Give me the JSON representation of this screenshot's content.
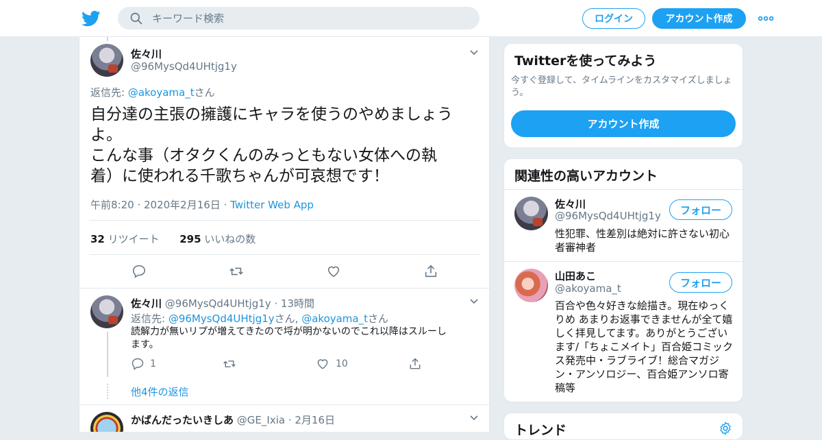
{
  "header": {
    "search_placeholder": "キーワード検索",
    "login_label": "ログイン",
    "signup_label": "アカウント作成"
  },
  "tweet": {
    "name": "佐々川",
    "handle": "@96MysQd4UHtjg1y",
    "reply_prefix": "返信先: ",
    "reply_to": "@akoyama_t",
    "reply_suffix": "さん",
    "text_lines": [
      "自分達の主張の擁護にキャラを使うのやめましょう",
      "よ。",
      "こんな事（オタクくんのみっともない女体への執",
      "着）に使われる千歌ちゃんが可哀想です！"
    ],
    "timestamp": "午前8:20 · 2020年2月16日 · ",
    "source": "Twitter Web App",
    "retweets_count": "32",
    "retweets_label": " リツイート",
    "likes_count": "295",
    "likes_label": " いいねの数"
  },
  "replies": [
    {
      "name": "佐々川",
      "handle": "@96MysQd4UHtjg1y",
      "time": " · 13時間",
      "reply_prefix": "返信先: ",
      "reply_to_1": "@96MysQd4UHtjg1y",
      "reply_mid": "さん, ",
      "reply_to_2": "@akoyama_t",
      "reply_suffix": "さん",
      "text_lines": [
        "読解力が無いリプが増えてきたので埒が明かないのでこれ以降はスルーし",
        "ます。"
      ],
      "reply_count": "1",
      "like_count": "10",
      "more_replies": "他4件の返信"
    },
    {
      "name": "かばんだったいきしあ",
      "handle": "@GE_Ixia",
      "time": " · 2月16日"
    }
  ],
  "sidebar": {
    "signup_card": {
      "title": "Twitterを使ってみよう",
      "desc_lines": [
        "今すぐ登録して、タイムラインをカスタマイズしましょ",
        "う。"
      ],
      "button": "アカウント作成"
    },
    "related": {
      "title": "関連性の高いアカウント",
      "accounts": [
        {
          "name": "佐々川",
          "handle": "@96MysQd4UHtjg1y",
          "follow": "フォロー",
          "bio_lines": [
            "性犯罪、性差別は絶対に許さない初心",
            "者審神者"
          ]
        },
        {
          "name": "山田あこ",
          "handle": "@akoyama_t",
          "follow": "フォロー",
          "bio_lines": [
            "百合や色々好きな絵描き。現在ゆっく",
            "りめ あまりお返事できませんが全て嬉",
            "しく拝見してます。ありがとうござい",
            "ます/「ちょこメイト」百合姫コミック",
            "ス発売中・ラブライブ！総合マガジ",
            "ン・アンソロジー、百合姫アンソロ寄",
            "稿等"
          ]
        }
      ]
    },
    "trends": {
      "title": "トレンド"
    }
  },
  "colors": {
    "accent": "#1da1f2",
    "link": "#1b95e0",
    "secondary_text": "#657786",
    "border": "#e1e8ed"
  }
}
